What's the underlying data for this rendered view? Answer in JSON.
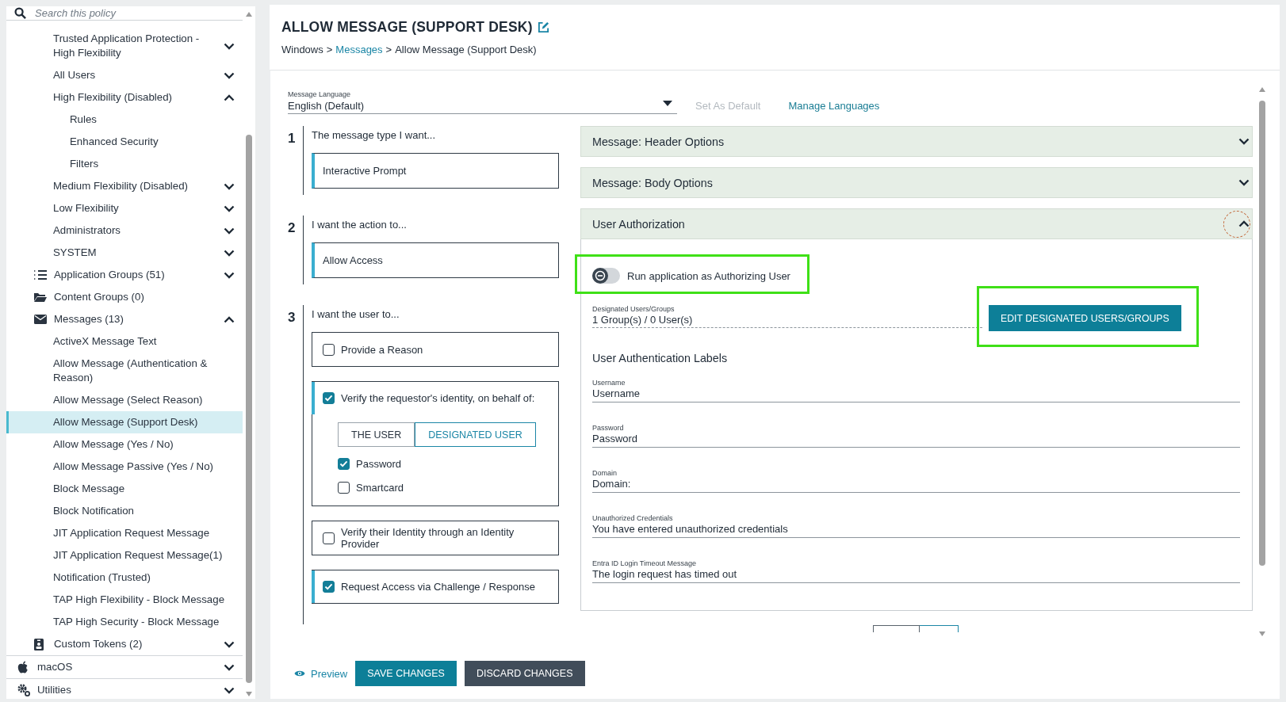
{
  "sidebar": {
    "search": {
      "placeholder": "Search this policy"
    },
    "items": [
      {
        "children": [
          {
            "children": [
              {
                "label": "Trusted Application Protection - High Flexibility",
                "expanded": false,
                "selected": false
              },
              {
                "label": "All Users",
                "expanded": false,
                "selected": false
              },
              {
                "label": "High Flexibility (Disabled)",
                "expanded": true,
                "selected": false,
                "children": [
                  {
                    "label": "Rules",
                    "selected": false
                  },
                  {
                    "label": "Enhanced Security",
                    "selected": false
                  },
                  {
                    "label": "Filters",
                    "selected": false
                  }
                ]
              },
              {
                "label": "Medium Flexibility (Disabled)",
                "expanded": false,
                "selected": false
              },
              {
                "label": "Low Flexibility",
                "expanded": false,
                "selected": false
              },
              {
                "label": "Administrators",
                "expanded": false,
                "selected": false
              },
              {
                "label": "SYSTEM",
                "expanded": false,
                "selected": false
              }
            ]
          },
          {
            "label": "Application Groups (51)",
            "kind": "list",
            "expanded": false,
            "selected": false
          },
          {
            "label": "Content Groups (0)",
            "kind": "folder",
            "selected": false
          },
          {
            "label": "Messages (13)",
            "kind": "mail",
            "expanded": true,
            "selected": false,
            "children": [
              {
                "label": "ActiveX Message Text",
                "selected": false
              },
              {
                "label": "Allow Message (Authentication & Reason)",
                "selected": false
              },
              {
                "label": "Allow Message (Select Reason)",
                "selected": false
              },
              {
                "label": "Allow Message (Support Desk)",
                "selected": true
              },
              {
                "label": "Allow Message (Yes / No)",
                "selected": false
              },
              {
                "label": "Allow Message Passive (Yes / No)",
                "selected": false
              },
              {
                "label": "Block Message",
                "selected": false
              },
              {
                "label": "Block Notification",
                "selected": false
              },
              {
                "label": "JIT Application Request Message",
                "selected": false
              },
              {
                "label": "JIT Application Request Message(1)",
                "selected": false
              },
              {
                "label": "Notification (Trusted)",
                "selected": false
              },
              {
                "label": "TAP High Flexibility - Block Message",
                "selected": false
              },
              {
                "label": "TAP High Security - Block Message",
                "selected": false
              }
            ]
          },
          {
            "label": "Custom Tokens (2)",
            "kind": "badge",
            "expanded": false,
            "selected": false
          }
        ]
      },
      {
        "label": "macOS",
        "kind": "apple",
        "expanded": false,
        "selected": false
      },
      {
        "label": "Utilities",
        "kind": "gears",
        "expanded": false,
        "selected": false
      }
    ]
  },
  "page": {
    "title": "ALLOW MESSAGE (SUPPORT DESK)",
    "separator": ">",
    "breadcrumb": [
      {
        "label": "Windows",
        "link": false
      },
      {
        "label": "Messages",
        "link": true
      },
      {
        "label": "Allow Message (Support Desk)",
        "link": false
      }
    ]
  },
  "language": {
    "label": "Message Language",
    "value": "English (Default)",
    "actions": [
      {
        "label": "Set As Default",
        "disabled": true
      },
      {
        "label": "Manage Languages",
        "disabled": false
      }
    ]
  },
  "steps": [
    {
      "number": "1",
      "prompt": "The message type I want...",
      "kind": "select",
      "value": "Interactive Prompt"
    },
    {
      "number": "2",
      "prompt": "I want the action to...",
      "kind": "select",
      "value": "Allow Access"
    },
    {
      "number": "3",
      "prompt": "I want the user to...",
      "kind": "options",
      "options": [
        {
          "label": "Provide a Reason",
          "checked": false
        },
        {
          "label": "Verify the requestor's identity, on behalf of:",
          "checked": true,
          "segments": [
            {
              "label": "THE USER",
              "selected": false
            },
            {
              "label": "DESIGNATED USER",
              "selected": true
            }
          ],
          "methods": [
            {
              "label": "Password",
              "checked": true
            },
            {
              "label": "Smartcard",
              "checked": false
            }
          ]
        },
        {
          "label": "Verify their Identity through an Identity Provider",
          "checked": false
        },
        {
          "label": "Request Access via Challenge / Response",
          "checked": true
        }
      ]
    }
  ],
  "accordions": [
    {
      "title": "Message: Header Options",
      "expanded": false,
      "focused": false
    },
    {
      "title": "Message: Body Options",
      "expanded": false,
      "focused": false
    },
    {
      "title": "User Authorization",
      "expanded": true,
      "focused": true,
      "panel": {
        "toggle": {
          "label": "Run application as Authorizing User",
          "on": false,
          "highlighted": true
        },
        "designated": {
          "label": "Designated Users/Groups",
          "value": "1 Group(s) / 0 User(s)"
        },
        "edit_button": {
          "label": "EDIT DESIGNATED USERS/GROUPS",
          "highlighted": true
        },
        "labels_heading": "User Authentication Labels",
        "fields": [
          {
            "label": "Username",
            "value": "Username"
          },
          {
            "label": "Password",
            "value": "Password"
          },
          {
            "label": "Domain",
            "value": "Domain:"
          },
          {
            "label": "Unauthorized Credentials",
            "value": "You have entered unauthorized credentials"
          },
          {
            "label": "Entra ID Login Timeout Message",
            "value": "The login request has timed out"
          }
        ]
      }
    }
  ],
  "footer": {
    "preview": "Preview",
    "buttons": [
      {
        "label": "SAVE CHANGES",
        "kind": "primary"
      },
      {
        "label": "DISCARD CHANGES",
        "kind": "secondary"
      }
    ]
  }
}
